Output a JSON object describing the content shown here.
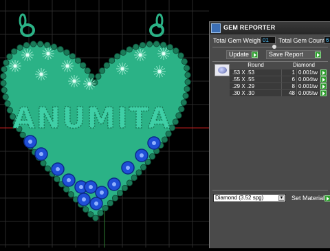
{
  "viewport": {
    "pendant_text": "ANUMITA",
    "colors": {
      "background": "#000000",
      "grid": "#2a2a2a",
      "metal": "#2bb286",
      "bead": "#1a7a58",
      "text_stones": "#3fcfa6",
      "sapphire": "#1f4fd6",
      "axis_red": "#c81e1e",
      "axis_green": "#2e7d32"
    }
  },
  "panel": {
    "title": "GEM REPORTER",
    "total_weight_label": "Total Gem Weight",
    "total_weight_value": "01",
    "total_count_label": "Total Gem Count",
    "total_count_value": "6",
    "update_label": "Update",
    "save_report_label": "Save Report",
    "table": {
      "columns": [
        "Round",
        "Diamond"
      ],
      "rows": [
        {
          "size": ".53 X .53",
          "count": "1",
          "weight": "0.001tw"
        },
        {
          "size": ".55 X .55",
          "count": "6",
          "weight": "0.004tw"
        },
        {
          "size": ".29 X .29",
          "count": "8",
          "weight": "0.001tw"
        },
        {
          "size": ".30 X .30",
          "count": "48",
          "weight": "0.005tw"
        }
      ]
    },
    "material_dropdown": "Diamond    (3.52 spg)",
    "set_material_label": "Set Material"
  }
}
